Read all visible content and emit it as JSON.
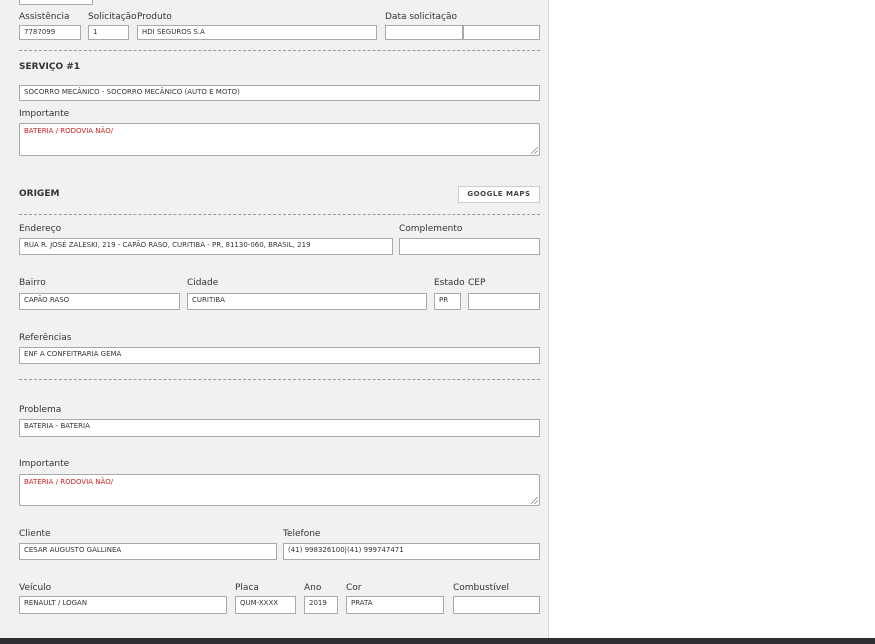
{
  "header_row": {
    "assistencia": {
      "label": "Assistência",
      "value": "7787099"
    },
    "solicitacao": {
      "label": "Solicitação",
      "value": "1"
    },
    "produto": {
      "label": "Produto",
      "value": "HDI SEGUROS S.A"
    },
    "data_solicitacao": {
      "label": "Data solicitação",
      "value_date": "",
      "value_time": ""
    }
  },
  "servico": {
    "title": "SERVIÇO #1",
    "tipo": "SOCORRO MECÂNICO - SOCORRO MECÂNICO (AUTO E MOTO)",
    "importante_label": "Importante",
    "importante_value": "BATERIA / RODOVIA NÃO/"
  },
  "origem": {
    "title": "ORIGEM",
    "google_maps_button": "GOOGLE MAPS",
    "endereco": {
      "label": "Endereço",
      "value": "RUA R. JOSÉ ZALESKI, 219 - CAPÃO RASO, CURITIBA - PR, 81130-060, BRASIL, 219"
    },
    "complemento": {
      "label": "Complemento",
      "value": ""
    },
    "bairro": {
      "label": "Bairro",
      "value": "CAPÃO RASO"
    },
    "cidade": {
      "label": "Cidade",
      "value": "CURITIBA"
    },
    "estado": {
      "label": "Estado",
      "value": "PR"
    },
    "cep": {
      "label": "CEP",
      "value": ""
    },
    "referencias": {
      "label": "Referências",
      "value": "ENF A CONFEITRARIA GEMA"
    }
  },
  "problema": {
    "label": "Problema",
    "value": "BATERIA - BATERIA"
  },
  "importante2": {
    "label": "Importante",
    "value": "BATERIA / RODOVIA NÃO/"
  },
  "cliente": {
    "label": "Cliente",
    "value": "CESAR AUGUSTO GALLINEA"
  },
  "telefone": {
    "label": "Telefone",
    "value": "(41) 998326100|(41) 999747471"
  },
  "veiculo": {
    "veiculo": {
      "label": "Veículo",
      "value": "RENAULT / LOGAN"
    },
    "placa": {
      "label": "Placa",
      "value": "QUM-XXXX"
    },
    "ano": {
      "label": "Ano",
      "value": "2019"
    },
    "cor": {
      "label": "Cor",
      "value": "PRATA"
    },
    "combustivel": {
      "label": "Combustível",
      "value": ""
    }
  },
  "colors": {
    "panel_bg": "#f1f1f1",
    "important_text": "#cc1f1f",
    "bottom_bar": "#2d2f33"
  }
}
